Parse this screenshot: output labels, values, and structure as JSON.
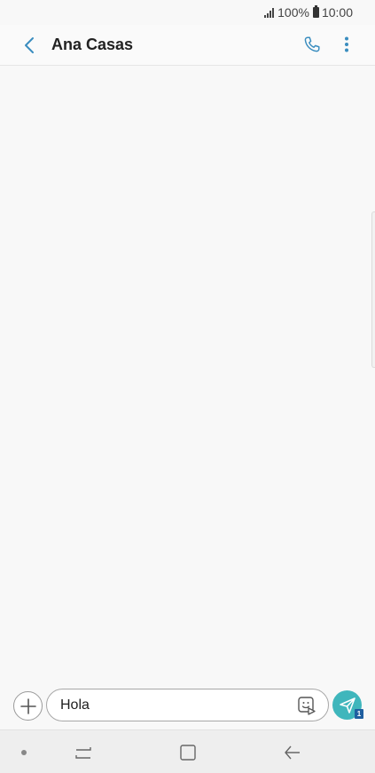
{
  "status_bar": {
    "battery": "100%",
    "time": "10:00"
  },
  "header": {
    "contact_name": "Ana Casas",
    "accent_color": "#3a8dbf"
  },
  "composer": {
    "message_value": "Hola",
    "send_color": "#3fb6bc",
    "sim_badge": "1"
  },
  "icons": {
    "back": "chevron-left-icon",
    "call": "phone-icon",
    "more": "more-vertical-icon",
    "add": "plus-icon",
    "sticker": "sticker-icon",
    "send": "send-icon"
  }
}
